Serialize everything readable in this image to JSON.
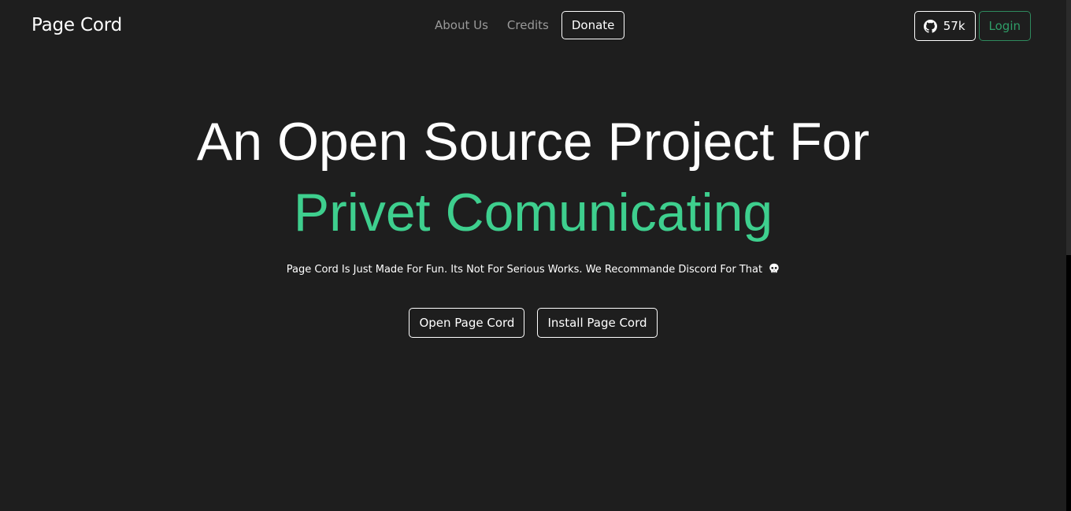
{
  "navbar": {
    "brand": "Page Cord",
    "links": [
      {
        "label": "About Us"
      },
      {
        "label": "Credits"
      }
    ],
    "donate_label": "Donate",
    "github": {
      "icon": "github-icon",
      "count": "57k"
    },
    "login_label": "Login"
  },
  "hero": {
    "line1": "An Open Source Project For",
    "line2": "Privet Comunicating",
    "tagline": "Page Cord Is Just Made For Fun. Its Not For Serious Works. We Recommande Discord For That",
    "tagline_emoji": "skull-icon",
    "buttons": [
      {
        "label": "Open Page Cord"
      },
      {
        "label": "Install Page Cord"
      }
    ]
  },
  "colors": {
    "background": "#1e1e1e",
    "accent_green": "#3ecf8e",
    "login_green": "#2f9e68",
    "nav_muted": "#9a9a9a"
  }
}
